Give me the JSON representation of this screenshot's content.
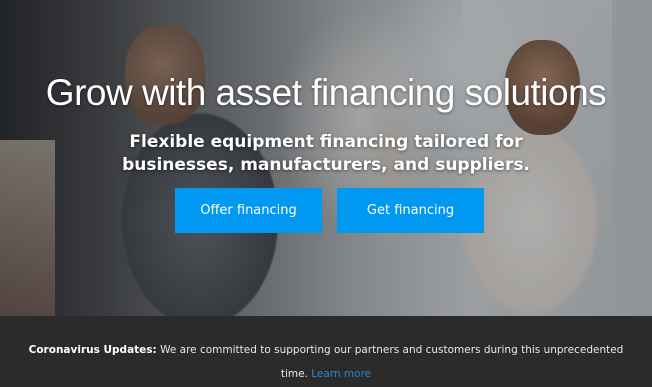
{
  "hero": {
    "headline": "Grow with asset financing solutions",
    "subheadline": "Flexible equipment financing tailored for businesses, manufacturers, and suppliers.",
    "buttons": {
      "offer_label": "Offer financing",
      "get_label": "Get financing"
    },
    "button_color": "#0098f0"
  },
  "banner": {
    "label": "Coronavirus Updates:",
    "message": "We are committed to supporting our partners and customers during this unprecedented time.",
    "link_label": "Learn more",
    "link_color": "#2f86c9",
    "background_color": "#2b2b2b"
  }
}
